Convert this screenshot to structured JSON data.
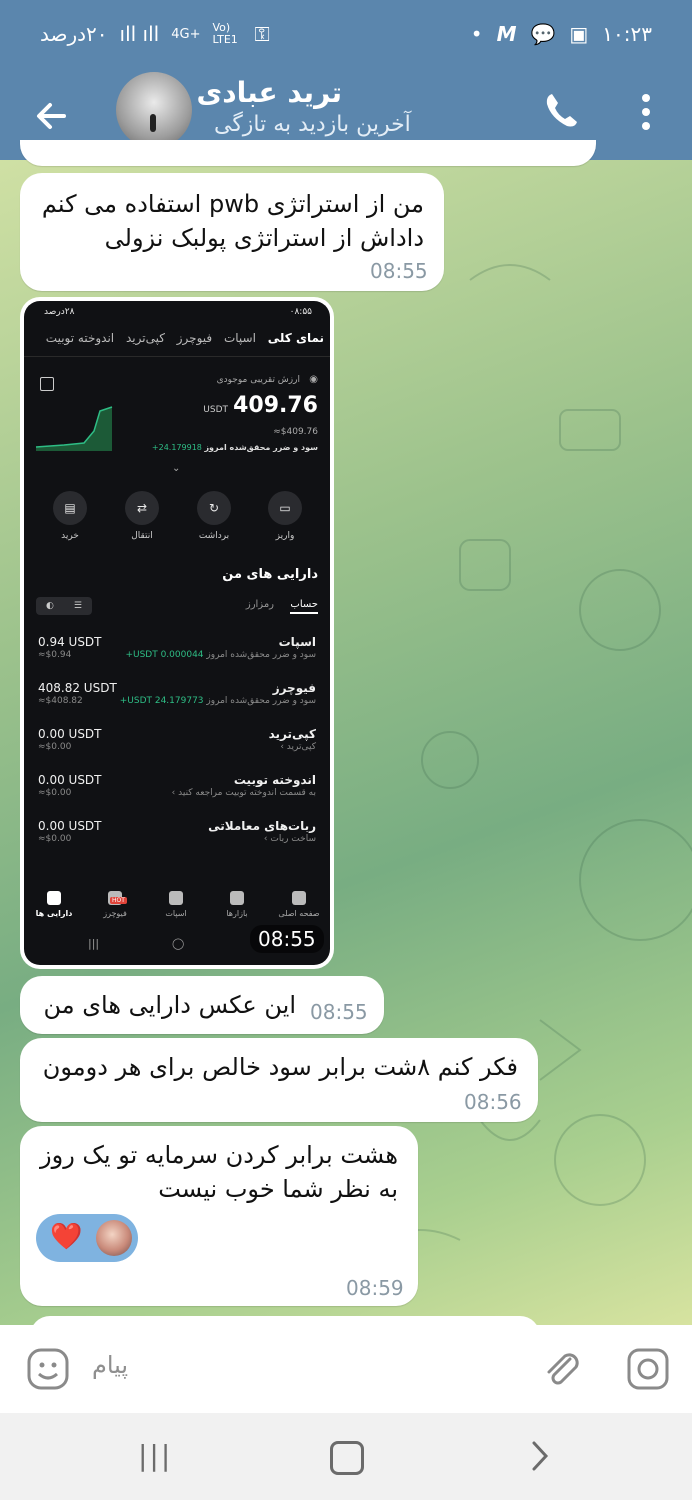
{
  "status_bar": {
    "time": "۱۰:۲۳",
    "battery": "۲۰درصد",
    "network": "4G+",
    "volte": "Vo) LTE1"
  },
  "header": {
    "contact_name": "ترید عبادی",
    "contact_status": "آخرین بازدید به تازگی"
  },
  "messages": [
    {
      "lines": [
        "من از استراتژی pwb استفاده می کنم",
        "داداش از استراتژی پولبک نزولی"
      ],
      "time": "08:55"
    },
    {
      "image_time": "08:55"
    },
    {
      "lines": [
        "این عکس دارایی های من"
      ],
      "time": "08:55"
    },
    {
      "lines": [
        "فکر کنم ۸شت برابر سود خالص برای هر دومون"
      ],
      "time": "08:56"
    },
    {
      "lines": [
        "هشت برابر کردن سرمایه تو یک روز",
        "به نظر شما خوب نیست"
      ],
      "time": "08:59",
      "reaction": "❤️"
    }
  ],
  "screenshot": {
    "status_time": "۰۸:۵۵",
    "status_battery": "۲۸درصد",
    "tabs": [
      "نمای کلی",
      "اسپات",
      "فیوچرز",
      "کپی‌ترید",
      "اندوخته توبیت"
    ],
    "balance_label": "ارزش تقریبی موجودی",
    "balance": "409.76",
    "balance_unit": "USDT",
    "balance_approx": "≈$409.76",
    "pnl_label": "سود و ضرر محقق‌شده امروز",
    "pnl_value": "24.179918+",
    "actions": [
      "واریز",
      "برداشت",
      "انتقال",
      "خرید"
    ],
    "assets_title": "دارایی های من",
    "asset_tabs": [
      "حساب",
      "رمزارز"
    ],
    "assets": [
      {
        "name": "اسپات",
        "sub": "سود و ضرر محقق‌شده امروز",
        "sub_value": "USDT 0.000044+",
        "amount": "0.94 USDT",
        "approx": "≈$0.94"
      },
      {
        "name": "فیوچرز",
        "sub": "سود و ضرر محقق‌شده امروز",
        "sub_value": "USDT 24.179773+",
        "amount": "408.82 USDT",
        "approx": "≈$408.82"
      },
      {
        "name": "کپی‌ترید",
        "sub": "کپی‌ترید ›",
        "sub_value": "",
        "amount": "0.00 USDT",
        "approx": "≈$0.00"
      },
      {
        "name": "اندوخته توبیت",
        "sub": "به قسمت اندوخته توبیت مراجعه کنید ›",
        "sub_value": "",
        "amount": "0.00 USDT",
        "approx": "≈$0.00"
      },
      {
        "name": "ربات‌های معاملاتی",
        "sub": "ساخت ربات ›",
        "sub_value": "",
        "amount": "0.00 USDT",
        "approx": "≈$0.00"
      }
    ],
    "bottom_nav": [
      "صفحه اصلی",
      "بازارها",
      "اسپات",
      "فیوچرز",
      "دارایی ها"
    ],
    "nav_badge": "HOT"
  },
  "composer": {
    "placeholder": "پیام"
  },
  "colors": {
    "header": "#5b86ad",
    "bubble": "#ffffff",
    "time": "#8a99a4",
    "positive": "#2ebd85"
  }
}
